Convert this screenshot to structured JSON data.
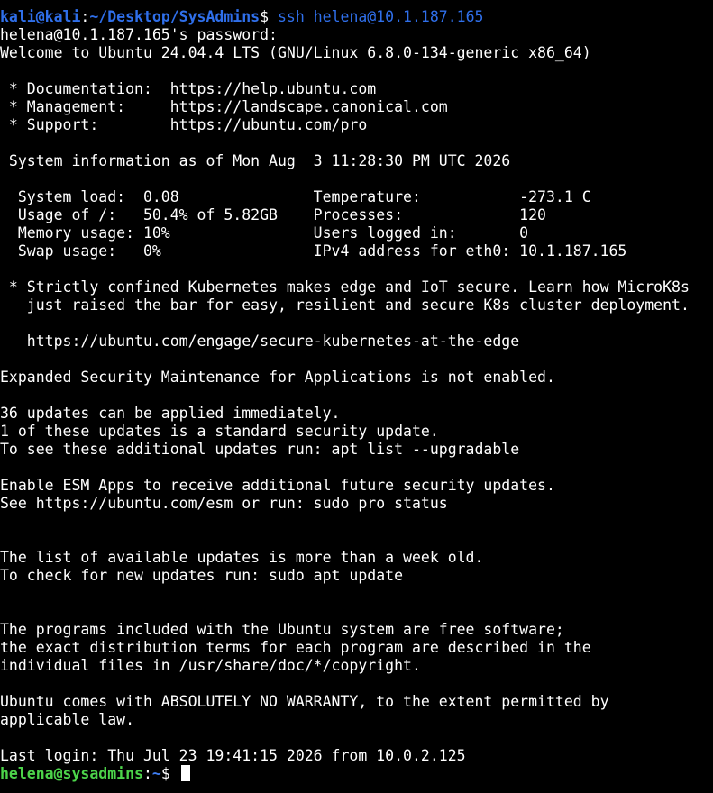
{
  "window": {
    "type": "terminal"
  },
  "colors": {
    "background": "#000000",
    "foreground": "#ffffff",
    "local_prompt": "#2f6fea",
    "remote_prompt_user": "#4cd34a",
    "remote_prompt_path": "#3f7ef3"
  },
  "session": {
    "local_prompt": {
      "user_host": "kali@kali",
      "separator": ":",
      "path": "~/Desktop/SysAdmins",
      "symbol": "$",
      "command": "ssh helena@10.1.187.165"
    },
    "lines": [
      "helena@10.1.187.165's password:",
      "Welcome to Ubuntu 24.04.4 LTS (GNU/Linux 6.8.0-134-generic x86_64)",
      "",
      " * Documentation:  https://help.ubuntu.com",
      " * Management:     https://landscape.canonical.com",
      " * Support:        https://ubuntu.com/pro",
      "",
      " System information as of Mon Aug  3 11:28:30 PM UTC 2026",
      "",
      "  System load:  0.08               Temperature:           -273.1 C",
      "  Usage of /:   50.4% of 5.82GB    Processes:             120",
      "  Memory usage: 10%                Users logged in:       0",
      "  Swap usage:   0%                 IPv4 address for eth0: 10.1.187.165",
      "",
      " * Strictly confined Kubernetes makes edge and IoT secure. Learn how MicroK8s",
      "   just raised the bar for easy, resilient and secure K8s cluster deployment.",
      "",
      "   https://ubuntu.com/engage/secure-kubernetes-at-the-edge",
      "",
      "Expanded Security Maintenance for Applications is not enabled.",
      "",
      "36 updates can be applied immediately.",
      "1 of these updates is a standard security update.",
      "To see these additional updates run: apt list --upgradable",
      "",
      "Enable ESM Apps to receive additional future security updates.",
      "See https://ubuntu.com/esm or run: sudo pro status",
      "",
      "",
      "The list of available updates is more than a week old.",
      "To check for new updates run: sudo apt update",
      "",
      "",
      "The programs included with the Ubuntu system are free software;",
      "the exact distribution terms for each program are described in the",
      "individual files in /usr/share/doc/*/copyright.",
      "",
      "Ubuntu comes with ABSOLUTELY NO WARRANTY, to the extent permitted by",
      "applicable law.",
      "",
      "Last login: Thu Jul 23 19:41:15 2026 from 10.0.2.125"
    ],
    "remote_prompt": {
      "user_host": "helena@sysadmins",
      "separator": ":",
      "path": "~",
      "symbol": "$"
    }
  }
}
